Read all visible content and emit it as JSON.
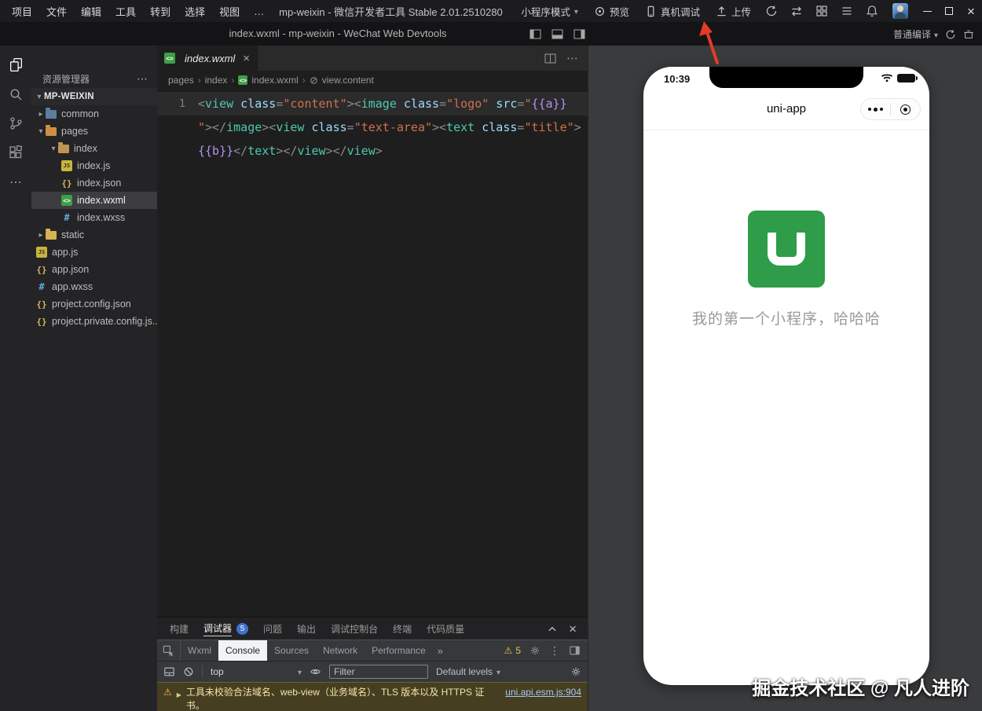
{
  "titlebar": {
    "menus": [
      "项目",
      "文件",
      "编辑",
      "工具",
      "转到",
      "选择",
      "视图",
      "…"
    ],
    "app_title": "mp-weixin - 微信开发者工具 Stable 2.01.2510280",
    "mode": "小程序模式",
    "preview": "预览",
    "remote_debug": "真机调试",
    "upload": "上传"
  },
  "window": {
    "title": "index.wxml - mp-weixin - WeChat Web Devtools",
    "compile_mode": "普通编译"
  },
  "explorer": {
    "title": "资源管理器",
    "root": "MP-WEIXIN",
    "tree": [
      {
        "label": "common",
        "type": "folder",
        "indent": 1,
        "expanded": false,
        "color": "#5b7e9e"
      },
      {
        "label": "pages",
        "type": "folder",
        "indent": 1,
        "expanded": true,
        "color": "#cf8e44"
      },
      {
        "label": "index",
        "type": "folder",
        "indent": 2,
        "expanded": true,
        "color": "#c09553"
      },
      {
        "label": "index.js",
        "type": "js",
        "indent": 3
      },
      {
        "label": "index.json",
        "type": "json",
        "indent": 3
      },
      {
        "label": "index.wxml",
        "type": "wxml",
        "indent": 3,
        "selected": true
      },
      {
        "label": "index.wxss",
        "type": "wxss",
        "indent": 3
      },
      {
        "label": "static",
        "type": "folder",
        "indent": 1,
        "expanded": false,
        "color": "#d8b353"
      },
      {
        "label": "app.js",
        "type": "js",
        "indent": 1
      },
      {
        "label": "app.json",
        "type": "json",
        "indent": 1
      },
      {
        "label": "app.wxss",
        "type": "wxss",
        "indent": 1
      },
      {
        "label": "project.config.json",
        "type": "json",
        "indent": 1
      },
      {
        "label": "project.private.config.js...",
        "type": "json",
        "indent": 1
      }
    ]
  },
  "editor": {
    "tab": "index.wxml",
    "breadcrumbs": [
      "pages",
      "index",
      "index.wxml",
      "view.content"
    ],
    "line_number": "1",
    "code_lines": [
      [
        [
          "p",
          "<"
        ],
        [
          "t",
          "view"
        ],
        [
          "n",
          " class"
        ],
        [
          "p",
          "="
        ],
        [
          "s",
          "\"content\""
        ],
        [
          "p",
          "><"
        ],
        [
          "t",
          "image"
        ],
        [
          "n",
          " class"
        ],
        [
          "p",
          "="
        ],
        [
          "s",
          "\"logo\""
        ],
        [
          "n",
          " src"
        ],
        [
          "p",
          "="
        ],
        [
          "s",
          "\""
        ],
        [
          "m",
          "{{a}}"
        ]
      ],
      [
        [
          "s",
          "\""
        ],
        [
          "p",
          "></"
        ],
        [
          "t",
          "image"
        ],
        [
          "p",
          "><"
        ],
        [
          "t",
          "view"
        ],
        [
          "n",
          " class"
        ],
        [
          "p",
          "="
        ],
        [
          "s",
          "\"text-area\""
        ],
        [
          "p",
          "><"
        ],
        [
          "t",
          "text"
        ],
        [
          "n",
          " class"
        ],
        [
          "p",
          "="
        ],
        [
          "s",
          "\"title\""
        ],
        [
          "p",
          ">"
        ]
      ],
      [
        [
          "m",
          "{{b}}"
        ],
        [
          "p",
          "</"
        ],
        [
          "t",
          "text"
        ],
        [
          "p",
          "></"
        ],
        [
          "t",
          "view"
        ],
        [
          "p",
          "></"
        ],
        [
          "t",
          "view"
        ],
        [
          "p",
          ">"
        ]
      ]
    ]
  },
  "panel": {
    "tabs": [
      {
        "label": "构建"
      },
      {
        "label": "调试器",
        "active": true,
        "badge": "5"
      },
      {
        "label": "问题"
      },
      {
        "label": "输出"
      },
      {
        "label": "调试控制台"
      },
      {
        "label": "终端"
      },
      {
        "label": "代码质量"
      }
    ],
    "devtools_tabs": [
      {
        "label": "Wxml"
      },
      {
        "label": "Console",
        "active": true
      },
      {
        "label": "Sources"
      },
      {
        "label": "Network"
      },
      {
        "label": "Performance"
      }
    ],
    "warn_count": "5",
    "context": "top",
    "filter_placeholder": "Filter",
    "levels": "Default levels",
    "warning": {
      "text": "工具未校验合法域名、web-view（业务域名）、TLS 版本以及 HTTPS 证书。",
      "link": "uni.api.esm.js:904"
    }
  },
  "simulator": {
    "time": "10:39",
    "nav_title": "uni-app",
    "caption": "我的第一个小程序，哈哈哈",
    "watermark": "掘金技术社区 @ 凡人进阶"
  }
}
